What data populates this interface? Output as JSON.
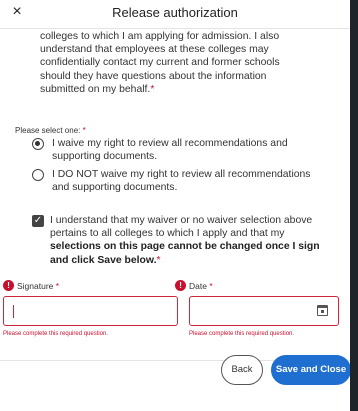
{
  "modal": {
    "title": "Release authorization",
    "close_icon": "×"
  },
  "body": {
    "intro_lines": [
      "colleges to which I am applying for admission. I also",
      "understand that employees at these colleges may",
      "confidentially contact my current and former schools",
      "should they have questions about the information",
      "submitted on my behalf."
    ],
    "intro_required_mark": "*"
  },
  "selection": {
    "prompt": "Please select one:",
    "prompt_required_mark": "*",
    "options": [
      {
        "lines": [
          "I waive my right to review all recommendations and",
          "supporting documents."
        ],
        "selected": true
      },
      {
        "lines": [
          "I DO NOT waive my right to review all recommendations",
          "and supporting documents."
        ],
        "selected": false
      }
    ]
  },
  "acknowledge": {
    "checked": true,
    "check_glyph": "✓",
    "line1": "I understand that my waiver or no waiver selection above",
    "line2": "pertains to all colleges to which I apply and that my",
    "bold_line3": "selections on this page cannot be changed once I sign",
    "bold_line4": "and click Save below.",
    "required_mark": "*"
  },
  "signature": {
    "label": "Signature",
    "required_mark": "*",
    "value": "",
    "error": "Please complete this required question.",
    "error_icon": "!"
  },
  "date": {
    "label": "Date",
    "required_mark": "*",
    "value": "",
    "error": "Please complete this required question.",
    "error_icon": "!",
    "calendar_icon": "calendar-icon"
  },
  "footer": {
    "back_label": "Back",
    "save_label": "Save and Close"
  },
  "colors": {
    "error": "#c8102e",
    "primary": "#1f6fd1",
    "backdrop": "#1f242b"
  }
}
